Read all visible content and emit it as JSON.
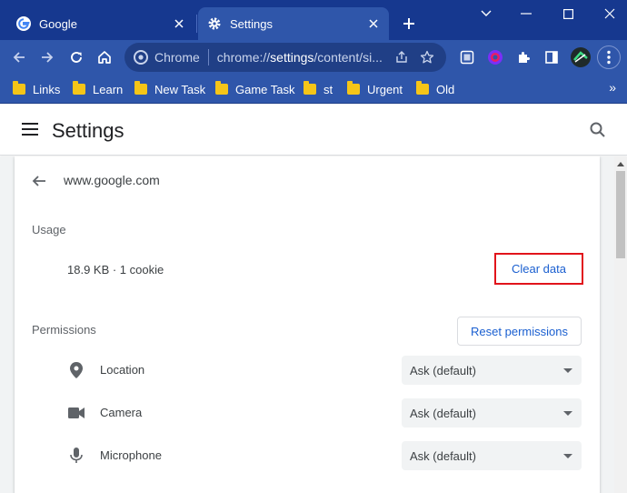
{
  "tabs": [
    {
      "title": "Google",
      "icon": "google-g-icon"
    },
    {
      "title": "Settings",
      "icon": "gear-icon"
    }
  ],
  "toolbar": {
    "omnibox_label": "Chrome",
    "url_prefix": "chrome://",
    "url_host": "settings",
    "url_rest": "/content/si..."
  },
  "bookmarks": [
    {
      "label": "Links"
    },
    {
      "label": "Learn"
    },
    {
      "label": "New Task"
    },
    {
      "label": "Game Task"
    },
    {
      "label": "st"
    },
    {
      "label": "Urgent"
    },
    {
      "label": "Old"
    }
  ],
  "bookmarks_more": "»",
  "header": {
    "title": "Settings"
  },
  "site": {
    "name": "www.google.com"
  },
  "usage": {
    "section_label": "Usage",
    "text": "18.9 KB · 1 cookie",
    "clear_label": "Clear data"
  },
  "permissions": {
    "section_label": "Permissions",
    "reset_label": "Reset permissions",
    "rows": [
      {
        "label": "Location",
        "value": "Ask (default)",
        "icon": "location-pin-icon"
      },
      {
        "label": "Camera",
        "value": "Ask (default)",
        "icon": "camera-icon"
      },
      {
        "label": "Microphone",
        "value": "Ask (default)",
        "icon": "microphone-icon"
      }
    ]
  },
  "colors": {
    "frame": "#2f56aa",
    "highlight": "#e1141b",
    "link": "#1a5fd0"
  }
}
